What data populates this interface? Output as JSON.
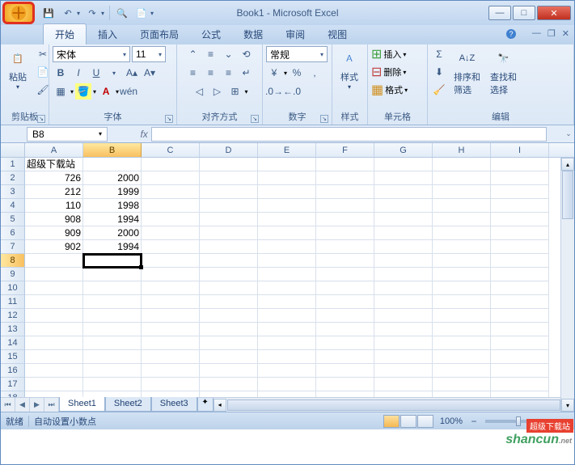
{
  "title": "Book1 - Microsoft Excel",
  "tabs": {
    "home": "开始",
    "insert": "插入",
    "layout": "页面布局",
    "formulas": "公式",
    "data": "数据",
    "review": "审阅",
    "view": "视图"
  },
  "ribbon": {
    "clipboard": {
      "label": "剪贴板",
      "paste": "粘贴"
    },
    "font": {
      "label": "字体",
      "family": "宋体",
      "size": "11"
    },
    "align": {
      "label": "对齐方式"
    },
    "number": {
      "label": "数字",
      "format": "常规"
    },
    "styles": {
      "label": "样式",
      "btn": "样式"
    },
    "cells": {
      "label": "单元格",
      "insert": "插入",
      "delete": "删除",
      "format": "格式"
    },
    "editing": {
      "label": "编辑",
      "sort": "排序和\n筛选",
      "find": "查找和\n选择"
    }
  },
  "namebox": "B8",
  "columns": [
    "A",
    "B",
    "C",
    "D",
    "E",
    "F",
    "G",
    "H",
    "I"
  ],
  "active_col": "B",
  "active_row": 8,
  "row_count": 18,
  "cells": {
    "1": {
      "A": {
        "v": "超级下载站",
        "t": "txt"
      }
    },
    "2": {
      "A": {
        "v": "726"
      },
      "B": {
        "v": "2000"
      }
    },
    "3": {
      "A": {
        "v": "212"
      },
      "B": {
        "v": "1999"
      }
    },
    "4": {
      "A": {
        "v": "110"
      },
      "B": {
        "v": "1998"
      }
    },
    "5": {
      "A": {
        "v": "908"
      },
      "B": {
        "v": "1994"
      }
    },
    "6": {
      "A": {
        "v": "909"
      },
      "B": {
        "v": "2000"
      }
    },
    "7": {
      "A": {
        "v": "902"
      },
      "B": {
        "v": "1994"
      }
    }
  },
  "sheets": {
    "s1": "Sheet1",
    "s2": "Sheet2",
    "s3": "Sheet3"
  },
  "status": {
    "ready": "就绪",
    "mode": "自动设置小数点",
    "zoom": "100%"
  },
  "watermark": "shancun",
  "watermark_suffix": ".net",
  "watermark_banner": "超级下载站"
}
